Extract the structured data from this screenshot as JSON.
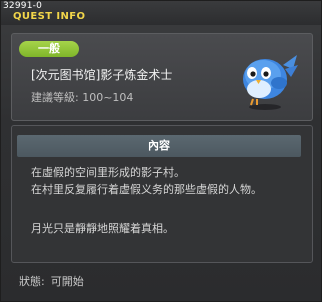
{
  "window": {
    "quest_id": "32991-0",
    "title": "QUEST INFO"
  },
  "quest": {
    "level_badge": "一般",
    "name": "[次元图书馆]影子炼金术士",
    "level_requirement": "建議等級: 100~104",
    "icon": "blue-bird-icon"
  },
  "content": {
    "header": "內容",
    "lines": [
      "在虛假的空间里形成的影子村。",
      "在村里反复履行着虚假义务的那些虚假的人物。",
      "",
      "月光只是靜靜地照耀着真相。"
    ]
  },
  "status": {
    "label": "狀態:",
    "value": "可開始"
  },
  "colors": {
    "title": "#f2d64a",
    "badge": "#8fc23a",
    "content_header": "#55626a",
    "background": "#2f3032"
  }
}
